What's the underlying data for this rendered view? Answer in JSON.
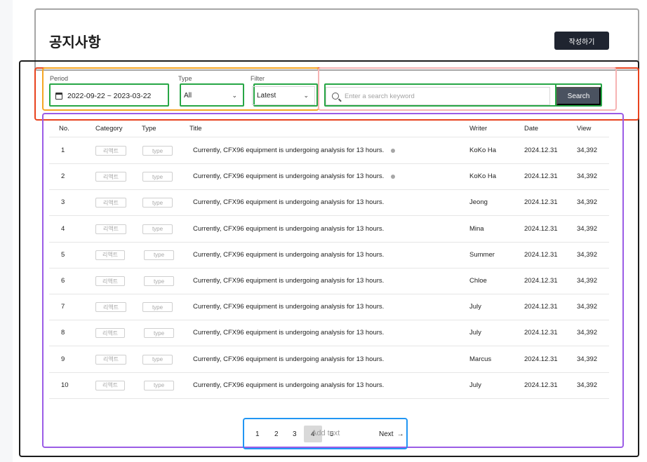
{
  "header": {
    "title": "공지사항",
    "write_button": "작성하기"
  },
  "filters": {
    "period_label": "Period",
    "period_value": "2022-09-22 ~ 2023-03-22",
    "type_label": "Type",
    "type_value": "All",
    "filter_label": "Filter",
    "filter_value": "Latest",
    "search_placeholder": "Enter a search keyword",
    "search_button": "Search"
  },
  "table": {
    "columns": [
      "No.",
      "Category",
      "Type",
      "Title",
      "Writer",
      "Date",
      "View"
    ],
    "rows": [
      {
        "no": "1",
        "category": "리액트",
        "type": "type",
        "title": "Currently, CFX96 equipment is undergoing analysis for 13 hours.",
        "dot": true,
        "writer": "KoKo Ha",
        "date": "2024.12.31",
        "view": "34,392"
      },
      {
        "no": "2",
        "category": "리액트",
        "type": "type",
        "title": "Currently, CFX96 equipment is undergoing analysis for 13 hours.",
        "dot": true,
        "writer": "KoKo Ha",
        "date": "2024.12.31",
        "view": "34,392"
      },
      {
        "no": "3",
        "category": "리액트",
        "type": "type",
        "title": "Currently, CFX96 equipment is undergoing analysis for 13 hours.",
        "dot": false,
        "writer": "Jeong",
        "date": "2024.12.31",
        "view": "34,392"
      },
      {
        "no": "4",
        "category": "리액트",
        "type": "type",
        "title": "Currently, CFX96 equipment is undergoing analysis for 13 hours.",
        "dot": false,
        "writer": "Mina",
        "date": "2024.12.31",
        "view": "34,392"
      },
      {
        "no": "5",
        "category": "리액트",
        "type": "type",
        "title": "Currently, CFX96 equipment is undergoing analysis for 13 hours.",
        "dot": false,
        "writer": "Summer",
        "date": "2024.12.31",
        "view": "34,392"
      },
      {
        "no": "6",
        "category": "리액트",
        "type": "type",
        "title": "Currently, CFX96 equipment is undergoing analysis for 13 hours.",
        "dot": false,
        "writer": "Chloe",
        "date": "2024.12.31",
        "view": "34,392"
      },
      {
        "no": "7",
        "category": "리액트",
        "type": "type",
        "title": "Currently, CFX96 equipment is undergoing analysis for 13 hours.",
        "dot": false,
        "writer": "July",
        "date": "2024.12.31",
        "view": "34,392"
      },
      {
        "no": "8",
        "category": "리액트",
        "type": "type",
        "title": "Currently, CFX96 equipment is undergoing analysis for 13 hours.",
        "dot": false,
        "writer": "July",
        "date": "2024.12.31",
        "view": "34,392"
      },
      {
        "no": "9",
        "category": "리액트",
        "type": "type",
        "title": "Currently, CFX96 equipment is undergoing analysis for 13 hours.",
        "dot": false,
        "writer": "Marcus",
        "date": "2024.12.31",
        "view": "34,392"
      },
      {
        "no": "10",
        "category": "리액트",
        "type": "type",
        "title": "Currently, CFX96 equipment is undergoing analysis for 13 hours.",
        "dot": false,
        "writer": "July",
        "date": "2024.12.31",
        "view": "34,392"
      }
    ]
  },
  "pagination": {
    "pages": [
      "1",
      "2",
      "3",
      "4",
      "5"
    ],
    "active_page": "4",
    "overlay_text": "Add text",
    "next_label": "Next",
    "next_arrow": "→"
  },
  "icons": {
    "calendar": "calendar-icon",
    "chevron": "chevron-down-icon",
    "search": "search-icon",
    "next": "arrow-right-icon"
  },
  "colors": {
    "write_button": "#1f2430",
    "search_button": "#4a5260",
    "active_page": "#d9d9d9"
  }
}
